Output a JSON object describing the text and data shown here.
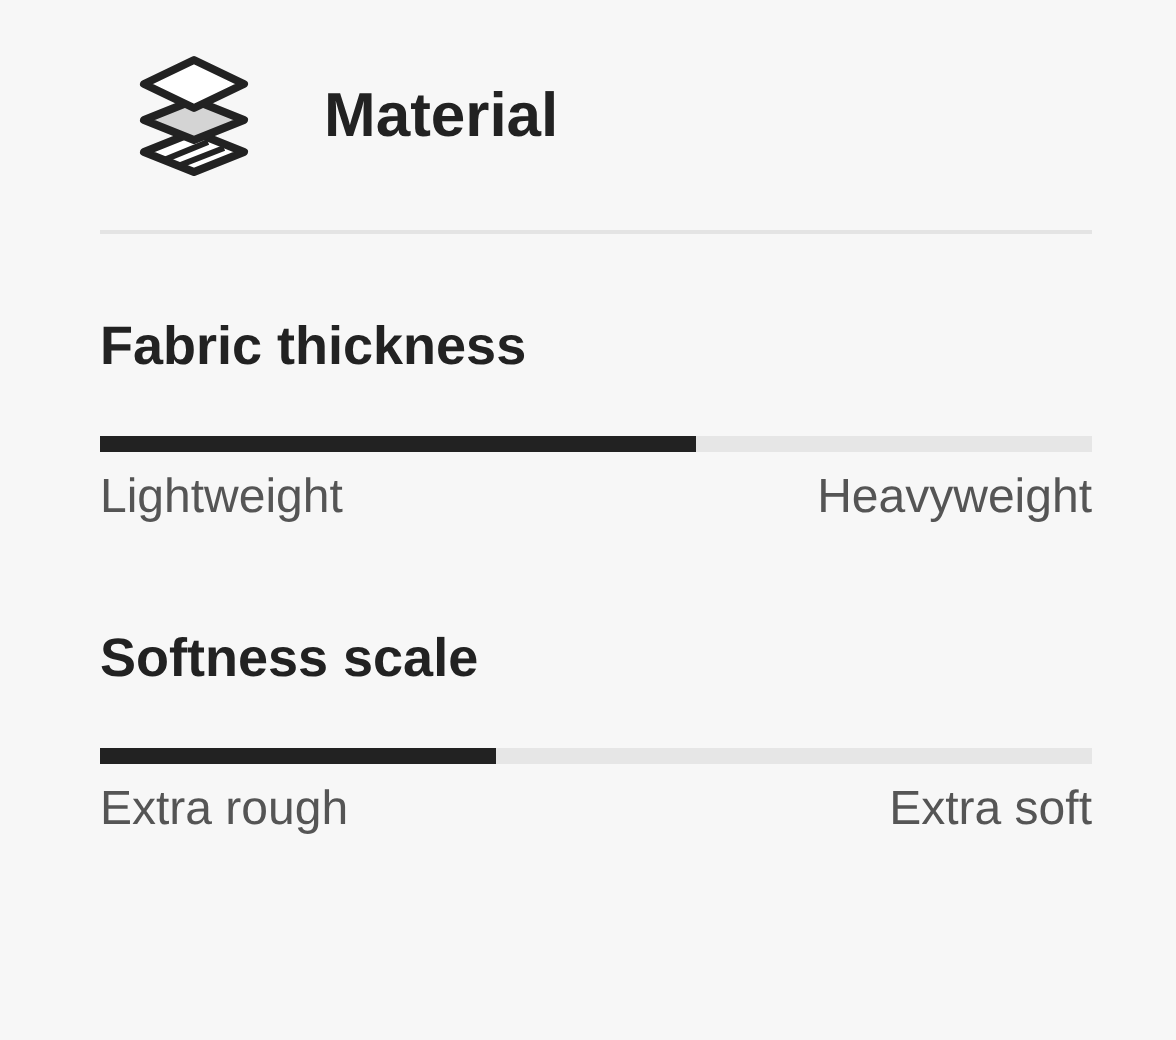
{
  "header": {
    "title": "Material"
  },
  "scales": [
    {
      "title": "Fabric thickness",
      "level": 0.6,
      "min_label": "Lightweight",
      "max_label": "Heavyweight"
    },
    {
      "title": "Softness scale",
      "level": 0.4,
      "min_label": "Extra rough",
      "max_label": "Extra soft"
    }
  ]
}
